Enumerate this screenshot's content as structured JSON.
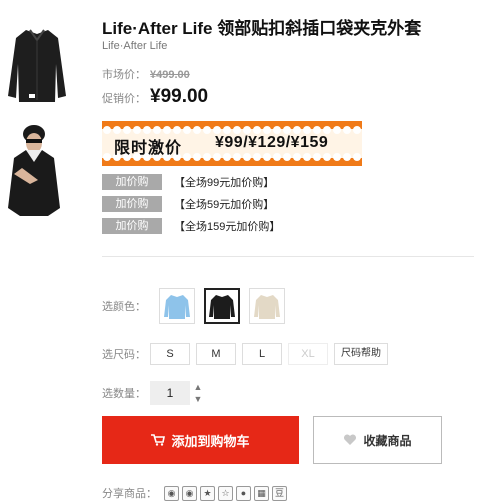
{
  "thumbnails": [
    {
      "name": "black-coat-flat"
    },
    {
      "name": "model-wearing-coat"
    }
  ],
  "product": {
    "title": "Life·After Life 领部贴扣斜插口袋夹克外套",
    "brand": "Life·After Life"
  },
  "price": {
    "market_label": "市场价：",
    "market_value": "¥499.00",
    "promo_label": "促销价：",
    "promo_value": "¥99.00"
  },
  "banner": {
    "label": "限时激价",
    "prices": "¥99/¥129/¥159",
    "accent": "#f07a18"
  },
  "add_buy": [
    {
      "tag": "加价购",
      "text": "【全场99元加价购】"
    },
    {
      "tag": "加价购",
      "text": "【全场59元加价购】"
    },
    {
      "tag": "加价购",
      "text": "【全场159元加价购】"
    }
  ],
  "color": {
    "label": "选颜色：",
    "options": [
      {
        "name": "light-blue",
        "hex": "#8ec3ea"
      },
      {
        "name": "black",
        "hex": "#1c1c1c"
      },
      {
        "name": "beige",
        "hex": "#e3d9c6"
      }
    ],
    "selected": "black"
  },
  "size": {
    "label": "选尺码：",
    "options": [
      "S",
      "M",
      "L",
      "XL"
    ],
    "disabled": [
      "XL"
    ],
    "help": "尺码帮助"
  },
  "quantity": {
    "label": "选数量：",
    "value": "1"
  },
  "actions": {
    "add_to_cart": "添加到购物车",
    "favorite": "收藏商品",
    "cart_color": "#e62817"
  },
  "share": {
    "label": "分享商品：",
    "icons": [
      "weibo-icon",
      "wechat-icon",
      "qzone-icon",
      "star-icon",
      "qq-icon",
      "renren-icon",
      "douban-icon"
    ],
    "douban_glyph": "豆"
  }
}
